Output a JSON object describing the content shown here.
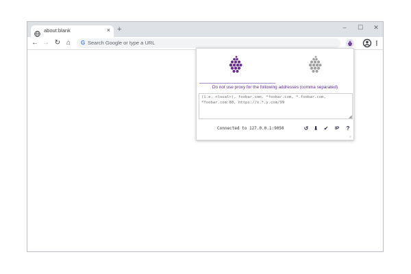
{
  "tab": {
    "title": "about:blank",
    "close_symbol": "×",
    "favicon": "globe-icon"
  },
  "new_tab_symbol": "+",
  "window_controls": {
    "minimize": "–",
    "maximize": "☐",
    "close": "✕"
  },
  "toolbar": {
    "back": "←",
    "forward": "→",
    "reload": "↻",
    "home": "⌂",
    "omnibox_logo": "G",
    "omnibox_placeholder": "Search Google or type a URL",
    "menu": "⋮",
    "extension_icon": "proxy-extension-icon",
    "profile_icon": "profile-icon"
  },
  "popup": {
    "mode_active_icon": "proxy-on-icon",
    "mode_inactive_icon": "proxy-off-icon",
    "bypass_label": "Do not use proxy for the following addresses (comma separated)",
    "bypass_value": "(i.e. <local>), foobar.com, *foobar.com, *.foobar.com, *foobar.com:80, https://x.*.y.com/99",
    "status": "Connected to 127.0.0.1:9050",
    "actions": {
      "reset": "↺",
      "download": "⬇",
      "apply": "✔",
      "ip": "IP",
      "help": "?"
    }
  },
  "colors": {
    "accent": "#6a2c91",
    "inactive": "#a0a0a0",
    "titlebar": "#dee1e6"
  }
}
